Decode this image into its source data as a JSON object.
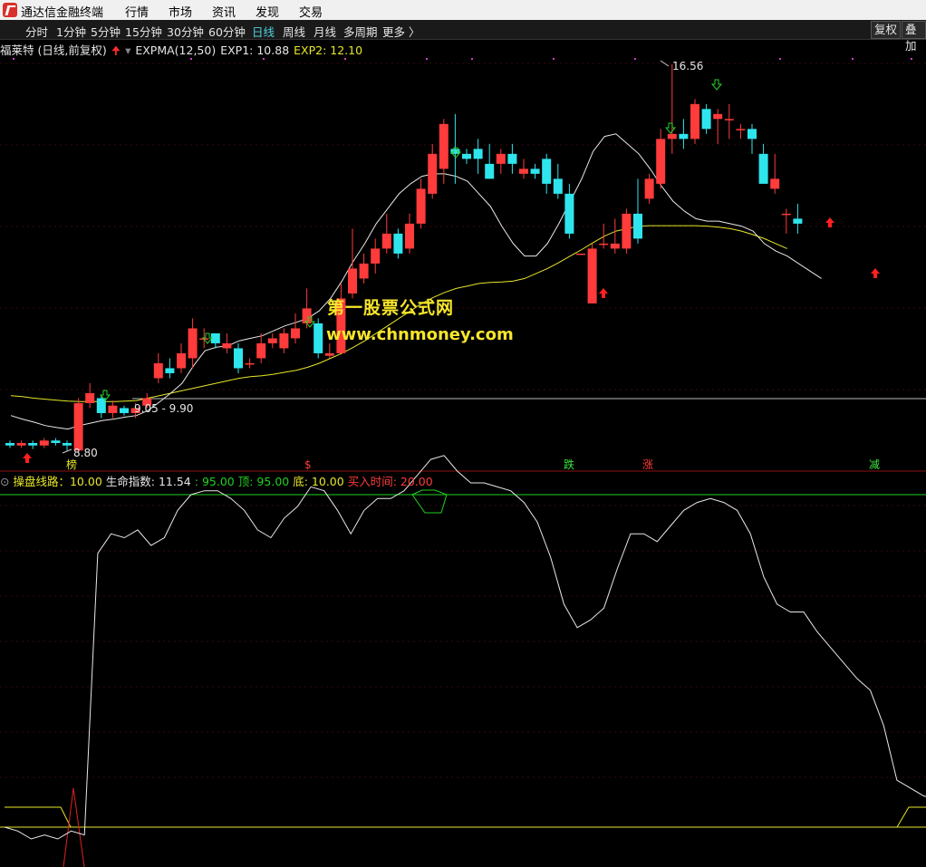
{
  "app": {
    "title": "通达信金融终端"
  },
  "menu": [
    "行情",
    "市场",
    "资讯",
    "发现",
    "交易"
  ],
  "periods": [
    {
      "label": "分时",
      "active": false
    },
    {
      "label": "1分钟",
      "active": false
    },
    {
      "label": "5分钟",
      "active": false
    },
    {
      "label": "15分钟",
      "active": false
    },
    {
      "label": "30分钟",
      "active": false
    },
    {
      "label": "60分钟",
      "active": false
    },
    {
      "label": "日线",
      "active": true
    },
    {
      "label": "周线",
      "active": false
    },
    {
      "label": "月线",
      "active": false
    },
    {
      "label": "多周期",
      "active": false
    },
    {
      "label": "更多 〉",
      "active": false
    }
  ],
  "right_buttons": {
    "fq": "复权",
    "overlay": "叠加"
  },
  "main_info": {
    "stock": "福莱特 (日线,前复权)",
    "indicator": "EXPMA(12,50)",
    "exp1": "EXP1: 10.88",
    "exp2": "EXP2: 12.10"
  },
  "watermark": {
    "line1": "第一股票公式网",
    "line2": "www.chnmoney.com"
  },
  "price_labels": {
    "high": "16.56",
    "low": "8.80",
    "range": "9.05 - 9.90"
  },
  "markers": {
    "bang": "榜",
    "dollar": "$",
    "die": "跌",
    "zhang": "涨",
    "jian": "减"
  },
  "sub_info": {
    "line": "操盘线路：10.00",
    "life": "生命指数: 11.54",
    "v95": ": 95.00",
    "top": "顶: 95.00",
    "bottom": "底: 10.00",
    "buy": "买入时间: 20.00"
  },
  "colors": {
    "up": "#ff3b3b",
    "down": "#2ee5ee",
    "exp1": "#e8e8e8",
    "exp2": "#e6e62a",
    "green": "#1fd11f",
    "yellow": "#e6e62a"
  },
  "chart_data": [
    {
      "type": "candlestick",
      "title": "福莱特 (日线,前复权)",
      "series": [
        {
          "name": "EXP1",
          "values": [
            9.55,
            9.48,
            9.42,
            9.35,
            9.31,
            9.28,
            9.35,
            9.4,
            9.45,
            9.48,
            9.52,
            9.55,
            9.65,
            9.82,
            10.0,
            10.2,
            10.55,
            10.85,
            10.92,
            10.95,
            11.05,
            11.1,
            11.15,
            11.25,
            11.35,
            11.42,
            11.5,
            11.65,
            11.9,
            12.25,
            12.65,
            13.0,
            13.4,
            13.7,
            14.0,
            14.2,
            14.35,
            14.4,
            14.4,
            14.35,
            14.25,
            14.0,
            13.75,
            13.35,
            13.0,
            12.75,
            12.75,
            13.0,
            13.4,
            13.85,
            14.3,
            14.85,
            15.15,
            15.2,
            15.0,
            14.8,
            14.5,
            14.15,
            13.85,
            13.65,
            13.5,
            13.45,
            13.45,
            13.4,
            13.35,
            13.25,
            13.0,
            12.85,
            12.75,
            12.6,
            12.45,
            12.3
          ]
        },
        {
          "name": "EXP2",
          "values": [
            9.95,
            9.93,
            9.9,
            9.88,
            9.86,
            9.84,
            9.83,
            9.83,
            9.83,
            9.83,
            9.84,
            9.85,
            9.9,
            9.95,
            10.0,
            10.05,
            10.1,
            10.15,
            10.2,
            10.25,
            10.3,
            10.33,
            10.35,
            10.38,
            10.42,
            10.46,
            10.52,
            10.6,
            10.7,
            10.8,
            10.92,
            11.05,
            11.2,
            11.35,
            11.5,
            11.65,
            11.8,
            11.92,
            12.02,
            12.1,
            12.15,
            12.2,
            12.22,
            12.23,
            12.25,
            12.3,
            12.4,
            12.5,
            12.62,
            12.75,
            12.88,
            13.02,
            13.15,
            13.25,
            13.3,
            13.35,
            13.36,
            13.36,
            13.36,
            13.36,
            13.36,
            13.35,
            13.33,
            13.3,
            13.25,
            13.18,
            13.1,
            13.0,
            12.9
          ]
        }
      ],
      "high": 16.56,
      "low": 8.8,
      "range_label": "9.05 - 9.90"
    },
    {
      "type": "line",
      "title": "操盘线路",
      "series": [
        {
          "name": "生命指数",
          "values": [
            10,
            9,
            7,
            8,
            7,
            9,
            8,
            80,
            85,
            84,
            86,
            82,
            84,
            91,
            95,
            96,
            96,
            94,
            91,
            86,
            84,
            89,
            92,
            97,
            96,
            91,
            85,
            91,
            94,
            94,
            96,
            100,
            104,
            105,
            101,
            98,
            98,
            97,
            96,
            93,
            88,
            79,
            67,
            61,
            63,
            66,
            76,
            85,
            85,
            83,
            87,
            91,
            93,
            94,
            93,
            91,
            85,
            74,
            67,
            65,
            65,
            60,
            56,
            52,
            48,
            45,
            36,
            22,
            20,
            18,
            17
          ]
        }
      ],
      "top": 95,
      "bottom": 10,
      "buy": 20
    }
  ]
}
